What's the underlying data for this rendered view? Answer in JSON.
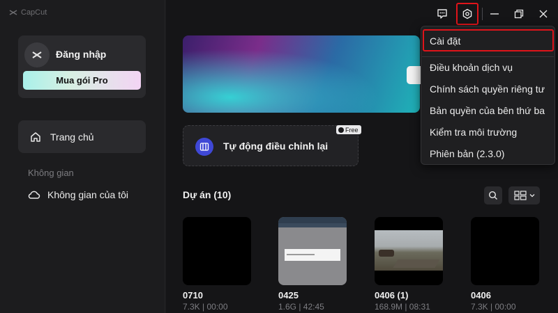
{
  "app": {
    "name": "CapCut"
  },
  "sidebar": {
    "login_label": "Đăng nhập",
    "pro_button": "Mua gói Pro",
    "home_label": "Trang chủ",
    "section_label": "Không gian",
    "space_label": "Không gian của tôi"
  },
  "main": {
    "auto_reframe_label": "Tự động điều chỉnh lại",
    "free_badge": "Free",
    "projects_title": "Dự án  (10)",
    "projects": [
      {
        "name": "0710",
        "meta": "7.3K | 00:00"
      },
      {
        "name": "0425",
        "meta": "1.6G | 42:45"
      },
      {
        "name": "0406 (1)",
        "meta": "168.9M | 08:31"
      },
      {
        "name": "0406",
        "meta": "7.3K | 00:00"
      }
    ]
  },
  "menu": {
    "items": [
      "Cài đặt",
      "Điều khoản dịch vụ",
      "Chính sách quyền riêng tư",
      "Bản quyền của bên thứ ba",
      "Kiểm tra môi trường",
      "Phiên bản (2.3.0)"
    ]
  },
  "icons": {
    "feedback": "feedback-icon",
    "settings": "settings-icon",
    "minimize": "minimize-icon",
    "restore": "restore-icon",
    "close": "close-icon",
    "home": "home-icon",
    "cloud": "cloud-icon",
    "search": "search-icon",
    "view": "grid-view-icon"
  },
  "colors": {
    "highlight": "#e0141a",
    "accent_blue": "#3f48d6"
  }
}
